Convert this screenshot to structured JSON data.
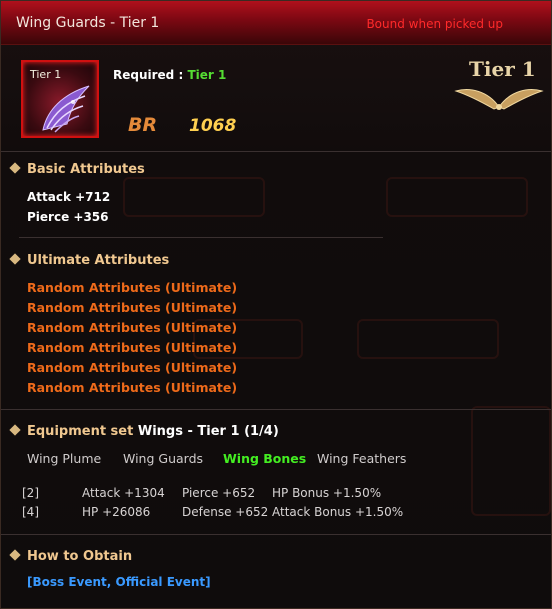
{
  "item": {
    "title": "Wing Guards - Tier 1",
    "bound_text": "Bound when picked up",
    "icon_tier_label": "Tier 1",
    "required_label": "Required :",
    "required_value": "Tier 1",
    "br_label": "BR",
    "br_value": "1068",
    "tier_badge": "Tier 1"
  },
  "basic": {
    "heading": "Basic Attributes",
    "attributes": [
      "Attack +712",
      "Pierce +356"
    ]
  },
  "ultimate": {
    "heading": "Ultimate Attributes",
    "attributes": [
      "Random Attributes (Ultimate)",
      "Random Attributes (Ultimate)",
      "Random Attributes (Ultimate)",
      "Random Attributes (Ultimate)",
      "Random Attributes (Ultimate)",
      "Random Attributes (Ultimate)"
    ]
  },
  "equipment_set": {
    "heading": "Equipment set",
    "set_name": "Wings - Tier 1 (1/4)",
    "parts": [
      {
        "label": "Wing Plume",
        "active": false
      },
      {
        "label": "Wing Guards",
        "active": false
      },
      {
        "label": "Wing Bones",
        "active": true
      },
      {
        "label": "Wing Feathers",
        "active": false
      }
    ],
    "bonuses": [
      {
        "count": "[2]",
        "a": "Attack +1304",
        "b": "Pierce +652",
        "c": "HP Bonus +1.50%"
      },
      {
        "count": "[4]",
        "a": "HP +26086",
        "b": "Defense +652",
        "c": "Attack Bonus +1.50%"
      }
    ]
  },
  "obtain": {
    "heading": "How to Obtain",
    "text": "[Boss Event, Official Event]"
  },
  "colors": {
    "header_red": "#b0101c",
    "bound_red": "#ff2a2a",
    "ultimate_orange": "#ee6a1a",
    "set_active_green": "#44ee22",
    "link_blue": "#3a9aff",
    "section_gold": "#f0c890"
  }
}
